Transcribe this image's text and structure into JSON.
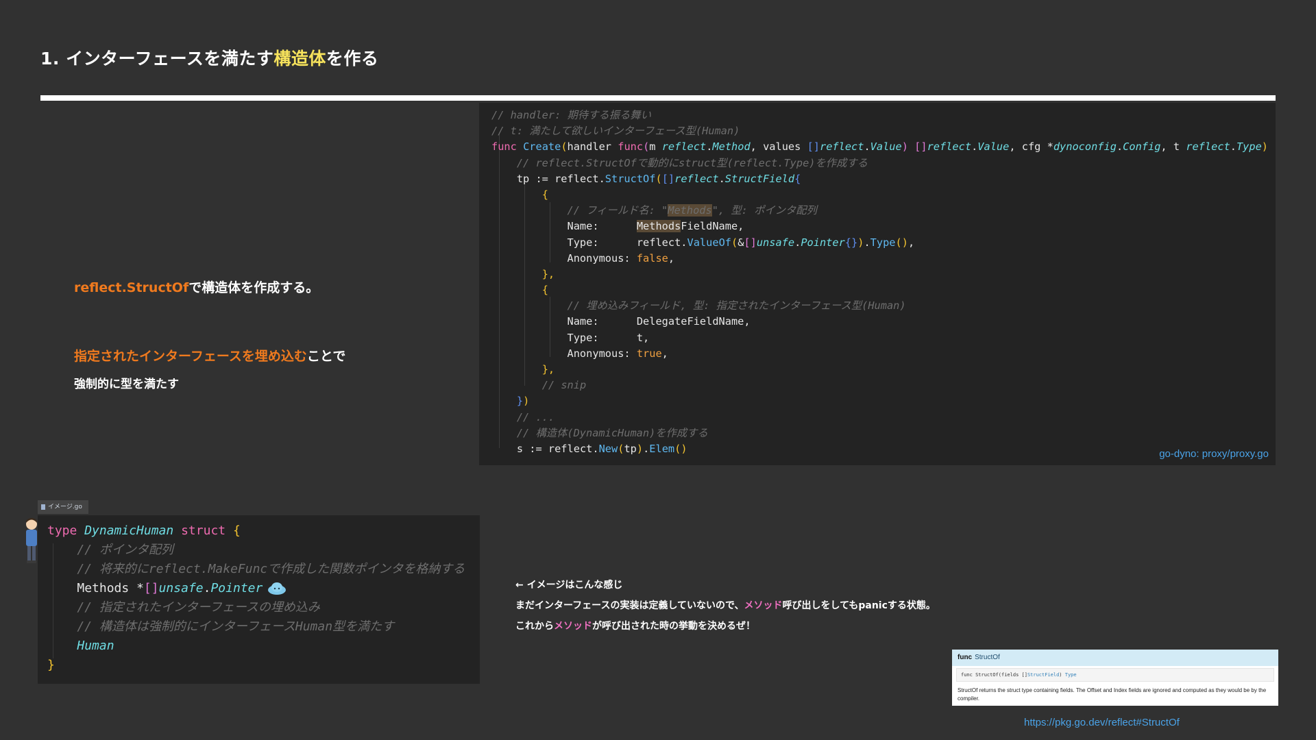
{
  "title": {
    "prefix": "1. インターフェースを満たす",
    "highlight": "構造体",
    "suffix": "を作る"
  },
  "notes": {
    "line1_code": "reflect.StructOf",
    "line1_text": "で構造体を作成する。",
    "line2_orange": "指定されたインターフェースを埋め込む",
    "line2_text": "ことで",
    "line3": "強制的に型を満たす"
  },
  "main_code": {
    "source": "go-dyno: proxy/proxy.go",
    "t": {
      "c1": "// handler: 期待する振る舞い",
      "c2": "// t: 満たして欲しいインターフェース型(Human)",
      "func": "func",
      "create": "Create",
      "handler": "handler ",
      "m": "m ",
      "reflect": "reflect",
      "dot": ".",
      "method": "Method",
      "values": "values ",
      "brk": "[]",
      "value": "Value",
      "comma": ", ",
      "cfg": "cfg ",
      "star": "*",
      "dynoconfig": "dynoconfig",
      "config": "Config",
      "t": "t ",
      "type": "Type",
      "c3": "// reflect.StructOfで動的にstruct型(reflect.Type)を作成する",
      "tp": "tp := reflect.",
      "structof": "StructOf",
      "structfield": "StructField",
      "lbrace": "{",
      "rbrace": "}",
      "c4a": "// フィールド名: \"",
      "c4b": "Methods",
      "c4c": "\", 型: ポインタ配列",
      "name_key": "Name:      ",
      "methods_hl": "Methods",
      "fieldname_rest": "FieldName,",
      "type_key": "Type:      ",
      "reflect_dot": "reflect.",
      "valueof": "ValueOf",
      "amp": "&",
      "unsafe": "unsafe",
      "pointer": "Pointer",
      "dot_type": "Type",
      "paren_end": "()",
      "comma_only": ",",
      "anon_key": "Anonymous: ",
      "false": "false",
      "close_item": "},",
      "c5": "// 埋め込みフィールド, 型: 指定されたインターフェース型(Human)",
      "delegate": "DelegateFieldName,",
      "t_comma": "t,",
      "true": "true",
      "c6": "// snip",
      "c7": "// ...",
      "c8": "// 構造体(DynamicHuman)を作成する",
      "s": "s := reflect.",
      "new": "New",
      "tp_arg": "tp",
      "elem": "Elem",
      "lp": "(",
      "rp": ")",
      "bparen": ")"
    }
  },
  "image_tab": {
    "label": "イメージ.go"
  },
  "bottom_code": {
    "t": {
      "type_kw": "type",
      "name": "DynamicHuman",
      "struct_kw": "struct",
      "lbrace": "{",
      "rbrace": "}",
      "c1": "// ポインタ配列",
      "c2": "// 将来的にreflect.MakeFuncで作成した関数ポインタを格納する",
      "methods": "Methods ",
      "star": "*",
      "brk": "[]",
      "unsafe": "unsafe",
      "dot": ".",
      "pointer": "Pointer",
      "c3": "// 指定されたインターフェースの埋め込み",
      "c4": "// 構造体は強制的にインターフェースHuman型を満たす",
      "human": "Human"
    }
  },
  "explanation": {
    "line1": "← イメージはこんな感じ",
    "line2_a": "まだインターフェースの実装は定義していないので、",
    "line2_pink": "メソッド",
    "line2_b": "呼び出しをしてもpanicする状態。",
    "line3_a": "これから",
    "line3_pink": "メソッド",
    "line3_b": "が呼び出された時の挙動を決めるぜ！"
  },
  "doc_card": {
    "func_kw": "func",
    "func_name": "StructOf",
    "sig_a": "func StructOf(fields []",
    "sig_link": "StructField",
    "sig_b": ") ",
    "sig_type": "Type",
    "desc": "StructOf returns the struct type containing fields. The Offset and Index fields are ignored and computed as they would be by the compiler.",
    "source": "https://pkg.go.dev/reflect#StructOf"
  },
  "colors": {
    "background": "#313131",
    "code_bg": "#232323",
    "title_highlight": "#f7e35c",
    "orange": "#f07a1e",
    "pink": "#ef6fc0",
    "link": "#4aa3e8"
  }
}
